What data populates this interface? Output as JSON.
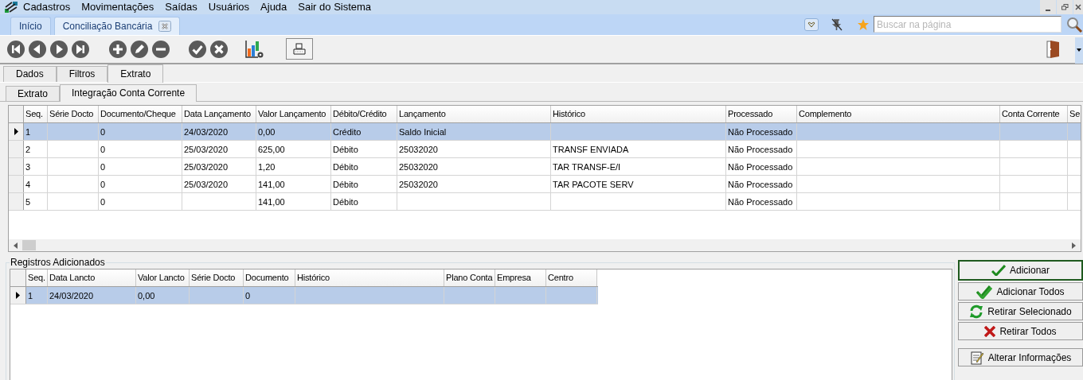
{
  "menu": [
    {
      "label": "Cadastros"
    },
    {
      "label": "Movimentações"
    },
    {
      "label": "Saídas"
    },
    {
      "label": "Usuários"
    },
    {
      "label": "Ajuda"
    },
    {
      "label": "Sair do Sistema"
    }
  ],
  "doc_tabs": [
    {
      "label": "Início",
      "selected": false,
      "closable": false
    },
    {
      "label": "Conciliação Bancária",
      "selected": true,
      "closable": true
    }
  ],
  "search": {
    "placeholder": "Buscar na página"
  },
  "toolbar": [
    {
      "kind": "first"
    },
    {
      "kind": "prev"
    },
    {
      "kind": "next"
    },
    {
      "kind": "last"
    },
    {
      "kind": "add"
    },
    {
      "kind": "edit"
    },
    {
      "kind": "delete"
    },
    {
      "kind": "confirm"
    },
    {
      "kind": "cancel"
    },
    {
      "kind": "chart"
    },
    {
      "kind": "print"
    }
  ],
  "tabs": [
    {
      "label": "Dados",
      "selected": false
    },
    {
      "label": "Filtros",
      "selected": false
    },
    {
      "label": "Extrato",
      "selected": true
    }
  ],
  "sub_tabs": [
    {
      "label": "Extrato",
      "selected": false
    },
    {
      "label": "Integração Conta Corrente",
      "selected": true
    }
  ],
  "table": {
    "columns": [
      "Seq.",
      "Série Docto",
      "Documento/Cheque",
      "Data Lançamento",
      "Valor Lançamento",
      "Débito/Crédito",
      "Lançamento",
      "Histórico",
      "Processado",
      "Complemento",
      "Conta Corrente",
      "Se"
    ],
    "rows": [
      {
        "selected": true,
        "cells": [
          "1",
          null,
          "0",
          "24/03/2020",
          "0,00",
          "Crédito",
          "Saldo Inicial",
          null,
          "Não Processado",
          null,
          null,
          null
        ]
      },
      {
        "selected": false,
        "cells": [
          "2",
          null,
          "0",
          "25/03/2020",
          "625,00",
          "Débito",
          "25032020",
          "TRANSF ENVIADA",
          "Não Processado",
          null,
          null,
          null
        ]
      },
      {
        "selected": false,
        "cells": [
          "3",
          null,
          "0",
          "25/03/2020",
          "1,20",
          "Débito",
          "25032020",
          "TAR TRANSF-E/I",
          "Não Processado",
          null,
          null,
          null
        ]
      },
      {
        "selected": false,
        "cells": [
          "4",
          null,
          "0",
          "25/03/2020",
          "141,00",
          "Débito",
          "25032020",
          "TAR PACOTE SERV",
          "Não Processado",
          null,
          null,
          null
        ]
      },
      {
        "selected": false,
        "cells": [
          "5",
          null,
          "0",
          null,
          "141,00",
          "Débito",
          null,
          null,
          "Não Processado",
          null,
          null,
          null
        ]
      }
    ]
  },
  "added": {
    "title": "Registros Adicionados",
    "columns": [
      "Seq.",
      "Data Lancto",
      "Valor Lancto",
      "Série Docto",
      "Documento",
      "Histórico",
      "Plano Conta",
      "Empresa",
      "Centro"
    ],
    "rows": [
      {
        "selected": true,
        "cells": [
          "1",
          "24/03/2020",
          "0,00",
          null,
          "0",
          null,
          null,
          null,
          null
        ]
      }
    ]
  },
  "actions": [
    {
      "kind": "add",
      "label": "Adicionar",
      "focused": true
    },
    {
      "kind": "add_all",
      "label": "Adicionar Todos",
      "focused": false
    },
    {
      "kind": "remove_selected",
      "label": "Retirar Selecionado",
      "focused": false
    },
    {
      "kind": "remove_all",
      "label": "Retirar Todos",
      "focused": false
    },
    {
      "kind": "edit_info",
      "label": "Alterar Informações",
      "focused": false
    }
  ]
}
